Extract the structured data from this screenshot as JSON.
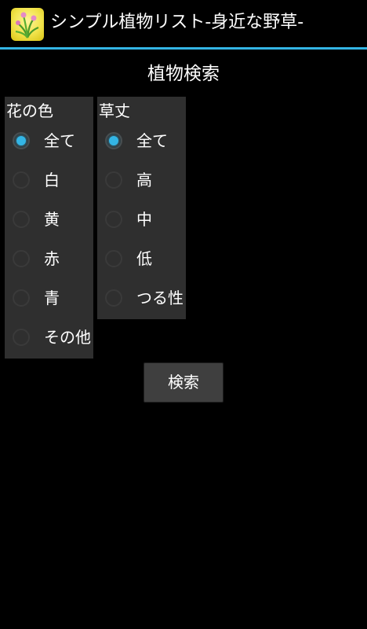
{
  "app": {
    "title": "シンプル植物リスト-身近な野草-",
    "icon": "plant-app-icon",
    "accent_color": "#33b5e5"
  },
  "screen": {
    "title": "植物検索"
  },
  "filters": {
    "flower_color": {
      "label": "花の色",
      "options": [
        {
          "label": "全て",
          "checked": true
        },
        {
          "label": "白",
          "checked": false
        },
        {
          "label": "黄",
          "checked": false
        },
        {
          "label": "赤",
          "checked": false
        },
        {
          "label": "青",
          "checked": false
        },
        {
          "label": "その他",
          "checked": false
        }
      ]
    },
    "plant_height": {
      "label": "草丈",
      "options": [
        {
          "label": "全て",
          "checked": true
        },
        {
          "label": "高",
          "checked": false
        },
        {
          "label": "中",
          "checked": false
        },
        {
          "label": "低",
          "checked": false
        },
        {
          "label": "つる性",
          "checked": false
        }
      ]
    }
  },
  "search_button": {
    "label": "検索"
  }
}
